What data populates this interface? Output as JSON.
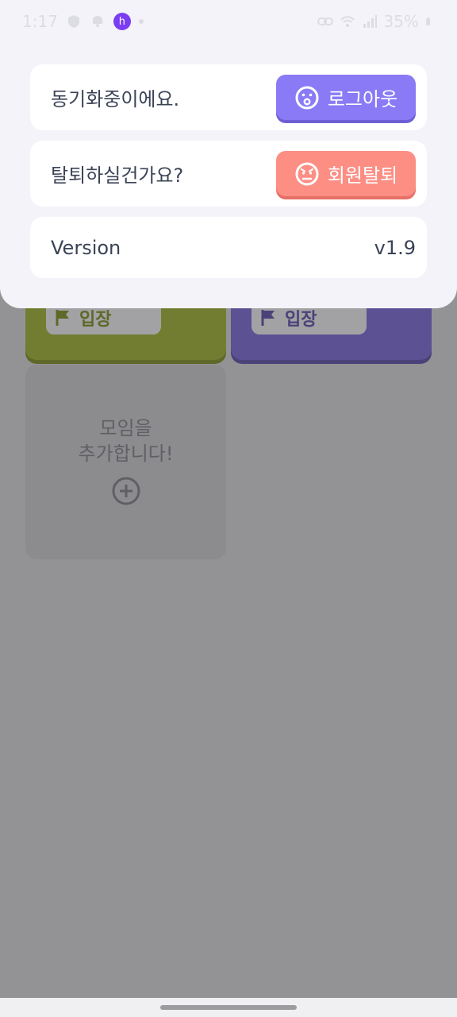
{
  "status_bar": {
    "time": "1:17",
    "battery": "35%",
    "app_badge": "h"
  },
  "background": {
    "cards": [
      {
        "enter_label": "입장",
        "color": "#737d31"
      },
      {
        "enter_label": "입장",
        "color": "#5b5193"
      }
    ],
    "add_group": {
      "line1": "모임을",
      "line2": "추가합니다!"
    }
  },
  "sheet": {
    "sync_row": {
      "label": "동기화중이에요.",
      "button_label": "로그아웃"
    },
    "withdraw_row": {
      "label": "탈퇴하실건가요?",
      "button_label": "회원탈퇴"
    },
    "version_row": {
      "label": "Version",
      "value": "v1.9"
    }
  },
  "colors": {
    "logout": "#8b7af5",
    "withdraw": "#fc8e84",
    "overlay": "#939395",
    "sheet": "#f3f3f9"
  }
}
